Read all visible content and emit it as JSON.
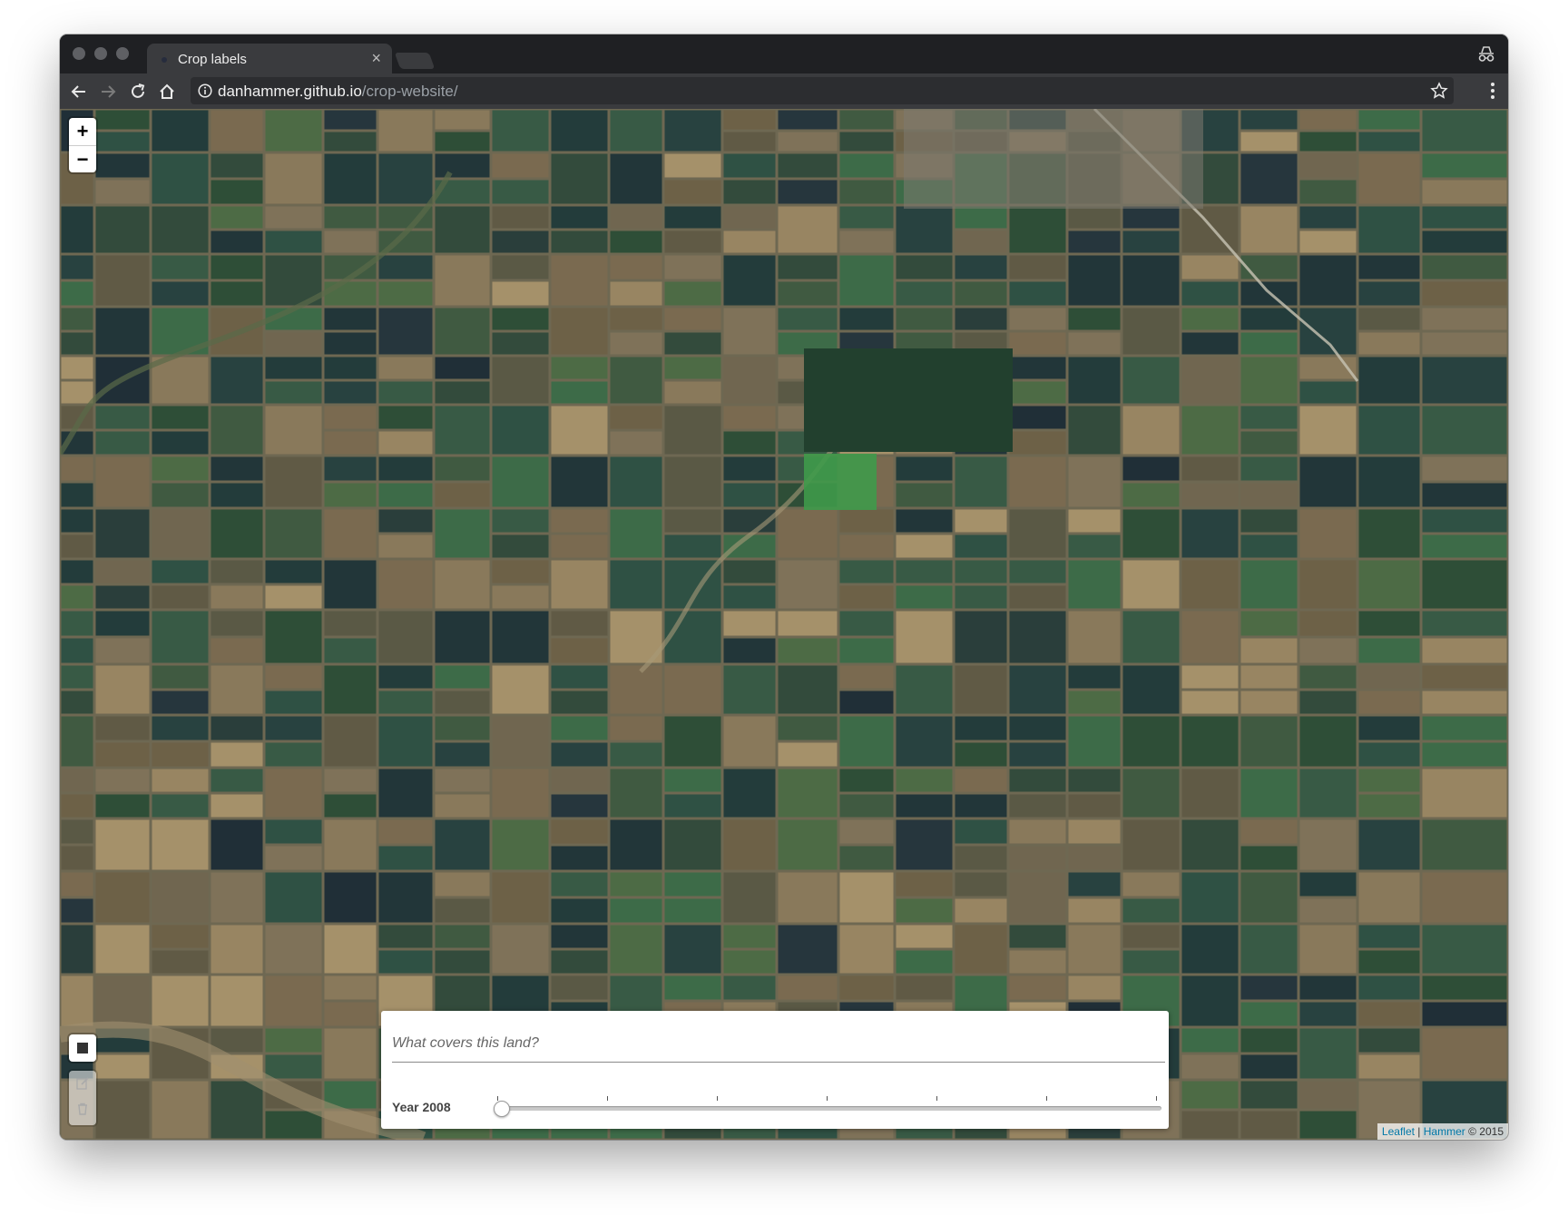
{
  "browser": {
    "tab_title": "Crop labels",
    "tab_close": "×",
    "url_host": "danhammer.github.io",
    "url_path": "/crop-website/",
    "icons": [
      "back-arrow-icon",
      "forward-arrow-icon",
      "reload-icon",
      "home-icon",
      "info-icon",
      "bookmark-star-icon",
      "menu-dots-icon",
      "incognito-icon"
    ]
  },
  "map": {
    "zoom_in": "+",
    "zoom_out": "−",
    "attribution": {
      "leaflet": "Leaflet",
      "separator": "|",
      "hammer": "Hammer",
      "copyright": "© 2015"
    }
  },
  "panel": {
    "placeholder": "What covers this land?",
    "year_label": "Year 2008",
    "slider_position": 0,
    "slider_ticks": 7
  }
}
